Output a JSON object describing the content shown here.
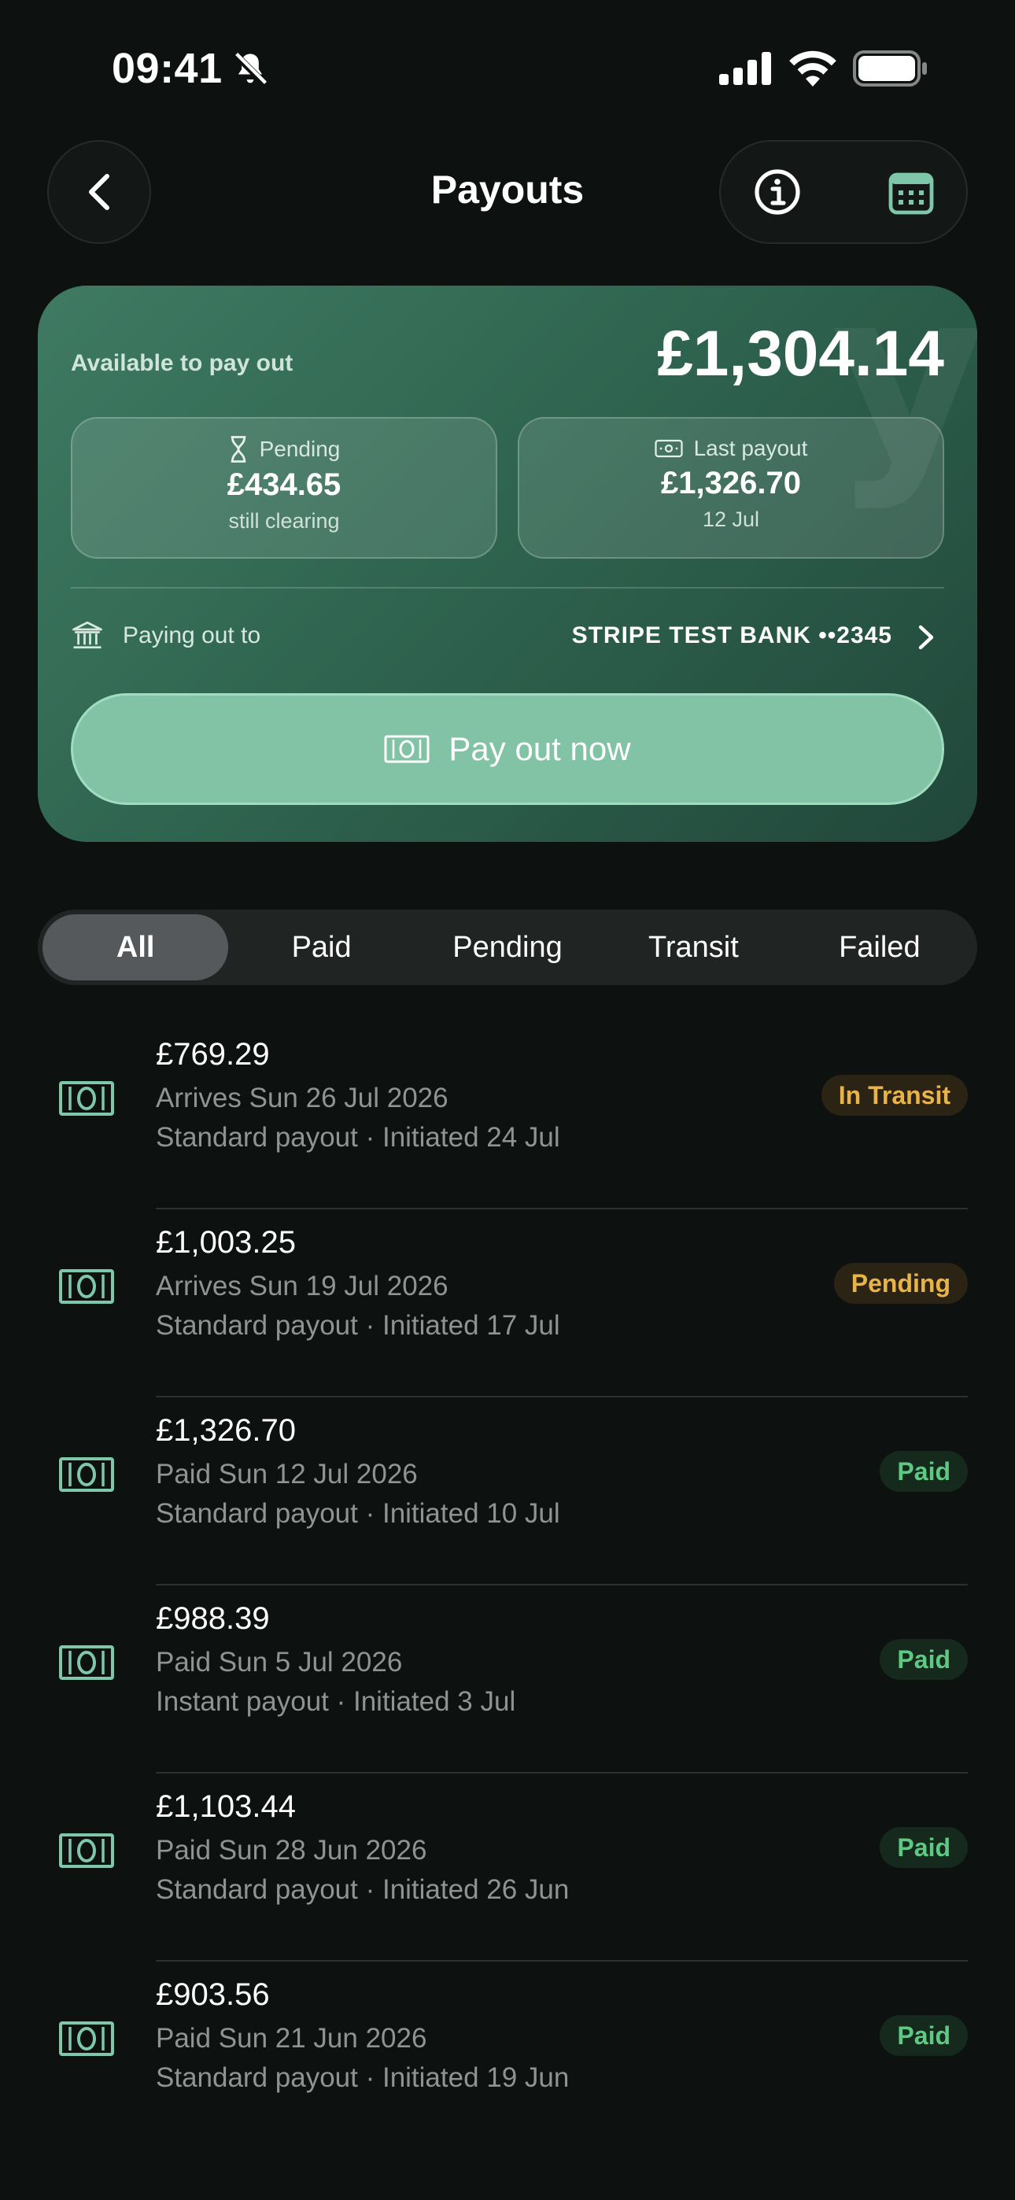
{
  "status_bar": {
    "time": "09:41"
  },
  "header": {
    "title": "Payouts"
  },
  "balance": {
    "available_label": "Available to pay out",
    "available_amount": "£1,304.14",
    "pending": {
      "label": "Pending",
      "amount": "£434.65",
      "sub": "still clearing"
    },
    "last_payout": {
      "label": "Last payout",
      "amount": "£1,326.70",
      "sub": "12 Jul"
    },
    "paying_label": "Paying out to",
    "bank_name": "STRIPE TEST BANK ••2345",
    "payout_button": "Pay out now"
  },
  "filters": {
    "active": "All",
    "tabs": [
      {
        "label": "All"
      },
      {
        "label": "Paid"
      },
      {
        "label": "Pending"
      },
      {
        "label": "Transit"
      },
      {
        "label": "Failed"
      }
    ]
  },
  "colors": {
    "accent": "#82c3a6",
    "icon": "#7fc7aa",
    "transit_text": "#e8b44a",
    "transit_bg": "#2b2414",
    "pending_text": "#e8b44a",
    "pending_bg": "#2b2414",
    "paid_text": "#5fc983",
    "paid_bg": "#16291d"
  },
  "payouts": [
    {
      "amount": "£769.29",
      "line1": "Arrives Sun 26 Jul 2026",
      "line2": "Standard payout · Initiated 24 Jul",
      "status": "In Transit",
      "status_type": "transit"
    },
    {
      "amount": "£1,003.25",
      "line1": "Arrives Sun 19 Jul 2026",
      "line2": "Standard payout · Initiated 17 Jul",
      "status": "Pending",
      "status_type": "pending"
    },
    {
      "amount": "£1,326.70",
      "line1": "Paid Sun 12 Jul 2026",
      "line2": "Standard payout · Initiated 10 Jul",
      "status": "Paid",
      "status_type": "paid"
    },
    {
      "amount": "£988.39",
      "line1": "Paid Sun 5 Jul 2026",
      "line2": "Instant payout · Initiated 3 Jul",
      "status": "Paid",
      "status_type": "paid"
    },
    {
      "amount": "£1,103.44",
      "line1": "Paid Sun 28 Jun 2026",
      "line2": "Standard payout · Initiated 26 Jun",
      "status": "Paid",
      "status_type": "paid"
    },
    {
      "amount": "£903.56",
      "line1": "Paid Sun 21 Jun 2026",
      "line2": "Standard payout · Initiated 19 Jun",
      "status": "Paid",
      "status_type": "paid"
    }
  ],
  "icons": [
    "bell-off-icon",
    "signal-icon",
    "wifi-icon",
    "battery-icon",
    "back-arrow-icon",
    "info-icon",
    "calendar-icon",
    "hourglass-icon",
    "banknote-icon",
    "bank-icon",
    "chevron-right-icon"
  ]
}
